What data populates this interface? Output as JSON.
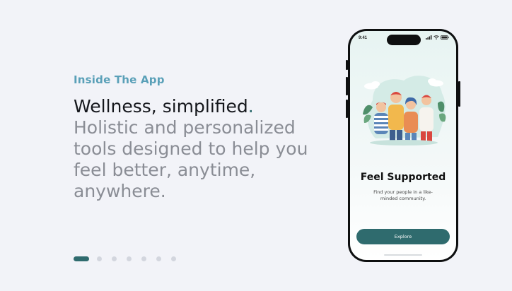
{
  "section": {
    "eyebrow": "Inside The App",
    "headline_strong": "Wellness, simplified",
    "headline_dot": ".",
    "headline_rest": "Holistic and personalized tools designed to help you feel better, anytime, anywhere."
  },
  "pager": {
    "total": 7,
    "active_index": 0
  },
  "phone": {
    "status_time": "9:41",
    "screen_title": "Feel Supported",
    "screen_subtitle": "Find your people in a like-minded community.",
    "primary_button": "Explore"
  },
  "colors": {
    "accent": "#2f6b6e",
    "eyebrow": "#5aa0b8",
    "headline_muted": "#8a8d95",
    "background": "#f2f3f8"
  }
}
